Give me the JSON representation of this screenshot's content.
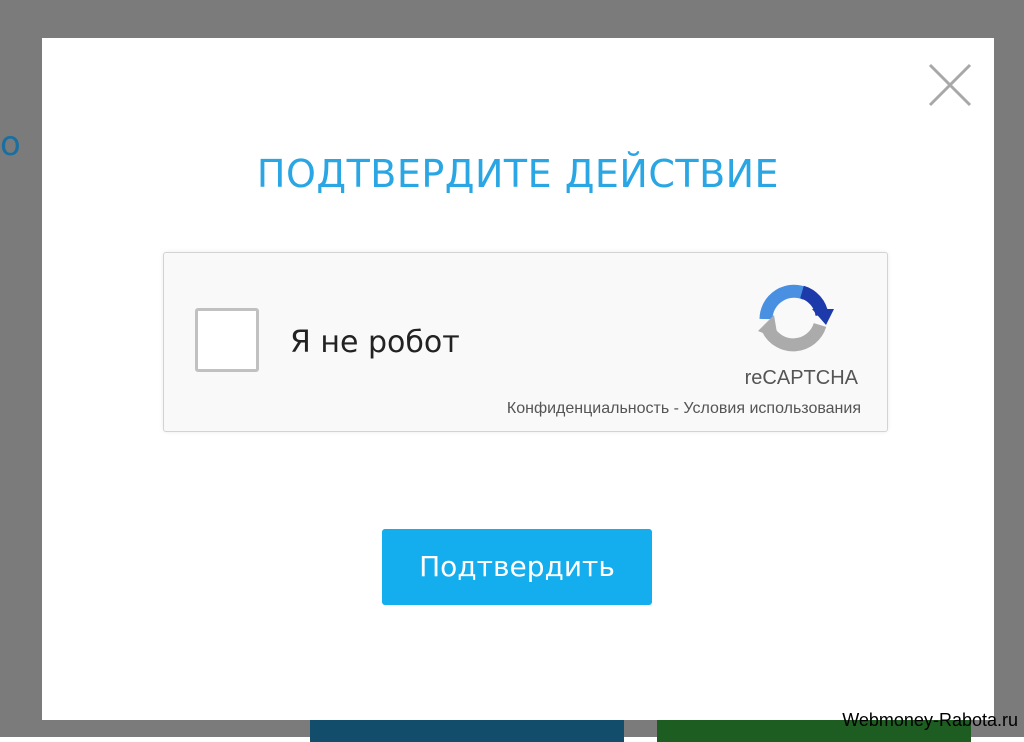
{
  "background": {
    "partial_text": "o"
  },
  "modal": {
    "title": "ПОДТВЕРДИТЕ ДЕЙСТВИЕ",
    "close_icon": "close-icon",
    "captcha": {
      "checkbox_label": "Я не робот",
      "checked": false,
      "brand": "reCAPTCHA",
      "privacy_link": "Конфиденциальность",
      "separator": " - ",
      "terms_link": "Условия использования"
    },
    "confirm_button": "Подтвердить"
  },
  "watermark": "Webmoney-Rabota.ru",
  "colors": {
    "title": "#29a6e3",
    "confirm_button": "#14aeef",
    "backdrop": "#7b7b7b"
  }
}
